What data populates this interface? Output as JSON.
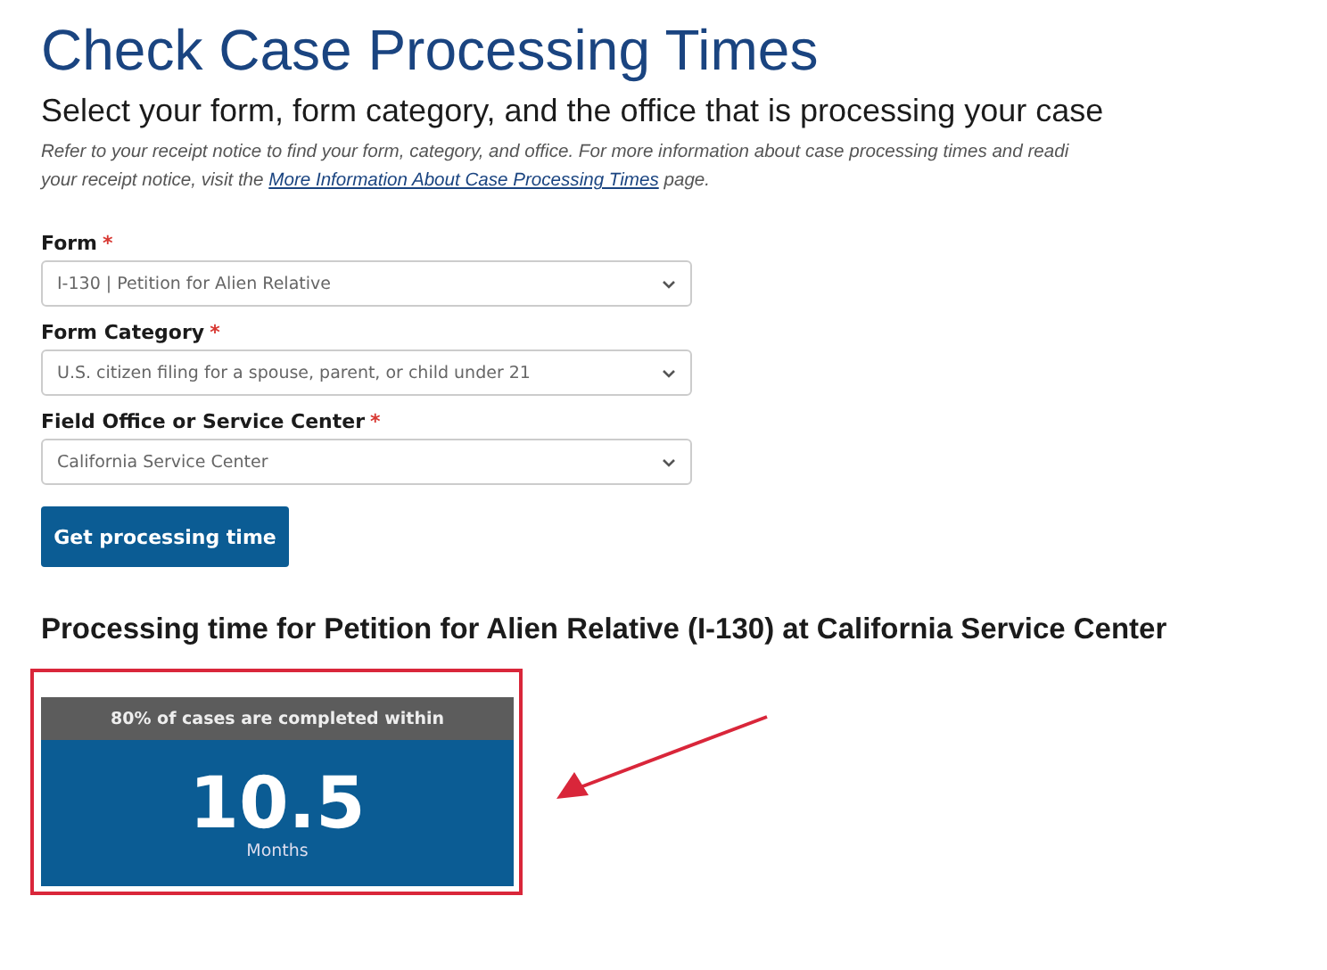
{
  "title": "Check Case Processing Times",
  "subtitle": "Select your form, form category, and the office that is processing your case",
  "intro": {
    "line_1": "Refer to your receipt notice to find your form, category, and office. For more information about case processing times and readi",
    "line_2": "your receipt notice, visit the",
    "link": "More Information About Case Processing Times",
    "line_2_end": "page."
  },
  "fields": [
    {
      "label": "Form",
      "required_mark": "*",
      "value": "I-130 | Petition for Alien Relative"
    },
    {
      "label": "Form Category",
      "required_mark": "*",
      "value": "U.S. citizen filing for a spouse, parent, or child under 21"
    },
    {
      "label": "Field Office or Service Center",
      "required_mark": "*",
      "value": "California Service Center"
    }
  ],
  "submit_button": "Get processing time",
  "result": {
    "heading": "Processing time for Petition for Alien Relative (I-130) at California Service Center",
    "card_header": "80% of cases are completed within",
    "value": "10.5",
    "unit": "Months",
    "highlighted": true
  }
}
